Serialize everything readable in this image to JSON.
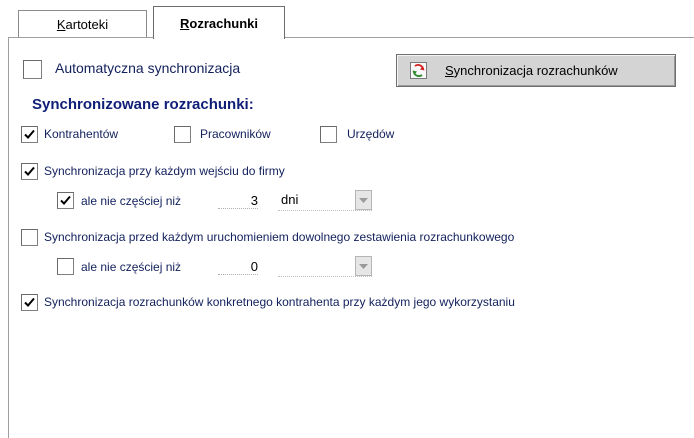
{
  "tabs": [
    {
      "label": "Kartoteki",
      "active": false
    },
    {
      "label": "Rozrachunki",
      "active": true
    }
  ],
  "auto_sync": {
    "label": "Automatyczna synchronizacja",
    "checked": false
  },
  "sync_button": {
    "label": "Synchronizacja rozrachunków",
    "icon": "sync-arrows-icon"
  },
  "section_title": "Synchronizowane rozrachunki:",
  "types": [
    {
      "label": "Kontrahentów",
      "checked": true
    },
    {
      "label": "Pracowników",
      "checked": false
    },
    {
      "label": "Urzędów",
      "checked": false
    }
  ],
  "sync_on_entry": {
    "label": "Synchronizacja przy każdym wejściu do firmy",
    "checked": true,
    "limit_label": "ale nie częściej niż",
    "limit_checked": true,
    "value": "3",
    "unit": "dni"
  },
  "sync_before_report": {
    "label": "Synchronizacja przed każdym uruchomieniem dowolnego zestawienia rozrachunkowego",
    "checked": false,
    "limit_label": "ale nie częściej niż",
    "limit_checked": false,
    "value": "0",
    "unit": ""
  },
  "sync_contractor": {
    "label": "Synchronizacja rozrachunków konkretnego kontrahenta przy każdym jego wykorzystaniu",
    "checked": true
  },
  "colors": {
    "accent_heading": "#0f1f78",
    "text": "#12205c",
    "button_bg": "#d4d4d4"
  }
}
